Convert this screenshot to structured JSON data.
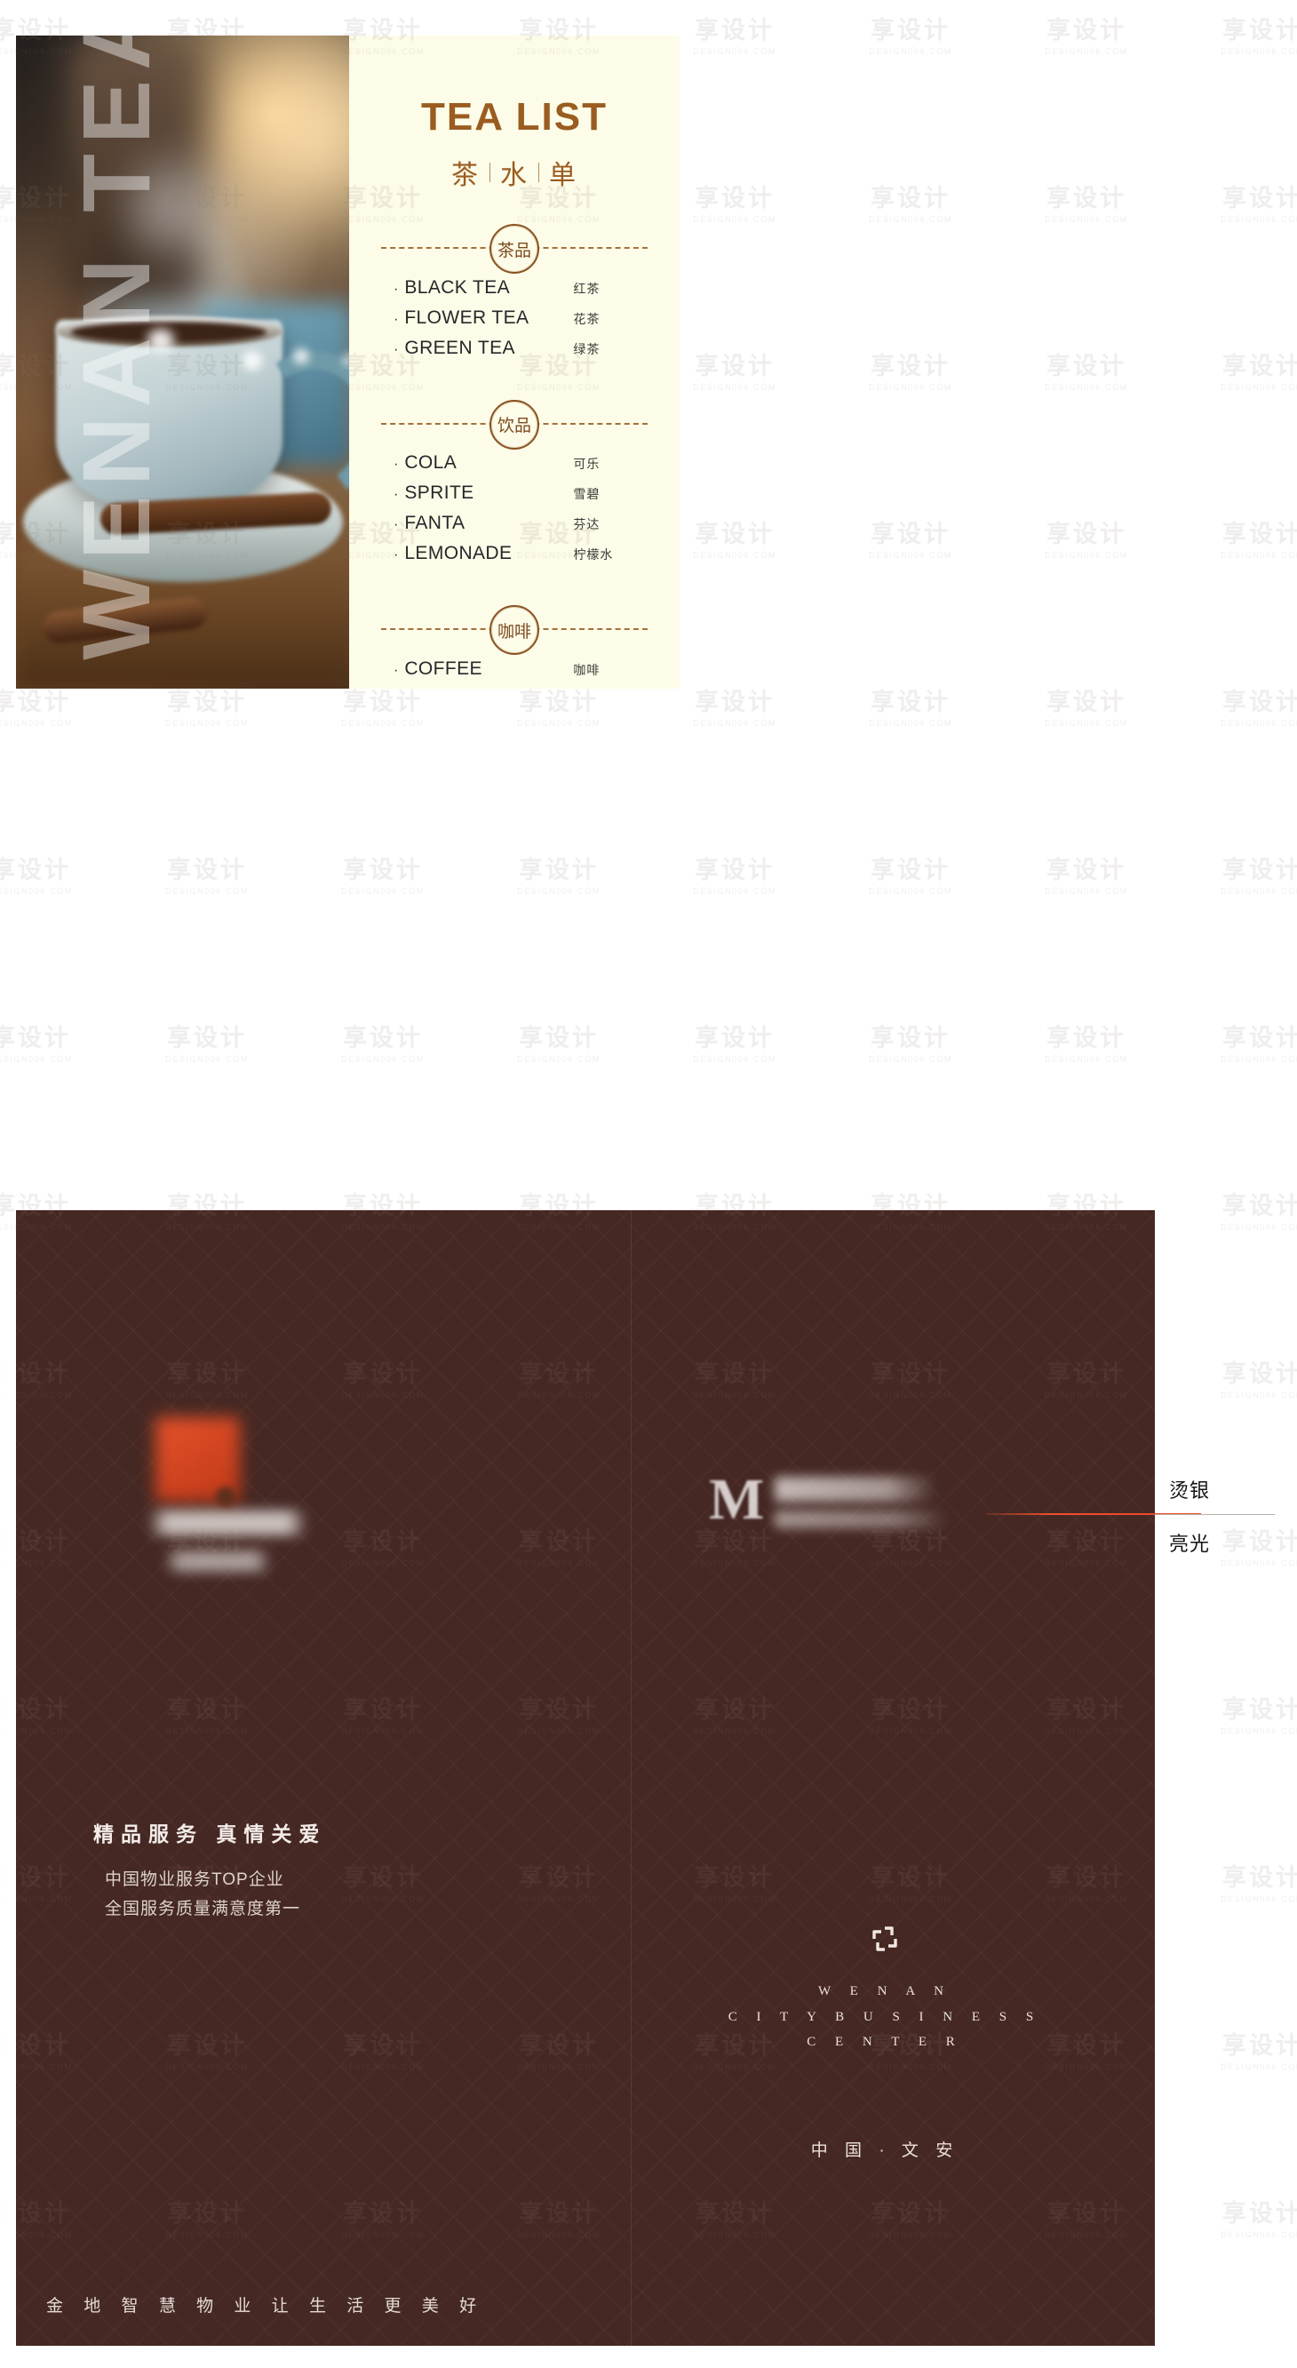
{
  "poster": {
    "background_color": "#ffffff",
    "card_cream": "#fcfce8",
    "card_dark": "#452823",
    "accent_brown": "#9a5c20",
    "accent_red": "#e8472a"
  },
  "top_card": {
    "vertical_text": "WENAN TEA",
    "title_en": "TEA LIST",
    "title_cn": [
      "茶",
      "水",
      "单"
    ],
    "sections": [
      {
        "stamp": "茶品",
        "items": [
          {
            "en": "BLACK TEA",
            "cn": "红茶"
          },
          {
            "en": "FLOWER TEA",
            "cn": "花茶"
          },
          {
            "en": "GREEN TEA",
            "cn": "绿茶"
          }
        ]
      },
      {
        "stamp": "饮品",
        "items": [
          {
            "en": "COLA",
            "cn": "可乐"
          },
          {
            "en": "SPRITE",
            "cn": "雪碧"
          },
          {
            "en": "FANTA",
            "cn": "芬达"
          },
          {
            "en": "LEMONADE",
            "cn": "柠檬水"
          }
        ]
      },
      {
        "stamp": "咖啡",
        "items": [
          {
            "en": "COFFEE",
            "cn": "咖啡"
          }
        ]
      }
    ],
    "bullet": "·"
  },
  "bottom_card": {
    "left": {
      "brand_logo": "jindi-logo",
      "slogan_main": "精品服务  真情关爱",
      "slogan_lines": [
        "中国物业服务TOP企业",
        "全国服务质量满意度第一"
      ],
      "footer": "金 地 智 慧 物 业   让 生 活 更 美 好"
    },
    "right": {
      "partner_logo_letter": "M",
      "center_logo_icon": "pinwheel-icon",
      "center_logo_lines": [
        "W E N A N",
        "C I T Y B U S I N E S S",
        "C E N T E R"
      ],
      "place": "中 国 · 文 安"
    }
  },
  "callout": {
    "top_label": "烫银",
    "bottom_label": "亮光"
  },
  "watermark": {
    "cn": "享设计",
    "en": "DESIGN006.COM"
  }
}
